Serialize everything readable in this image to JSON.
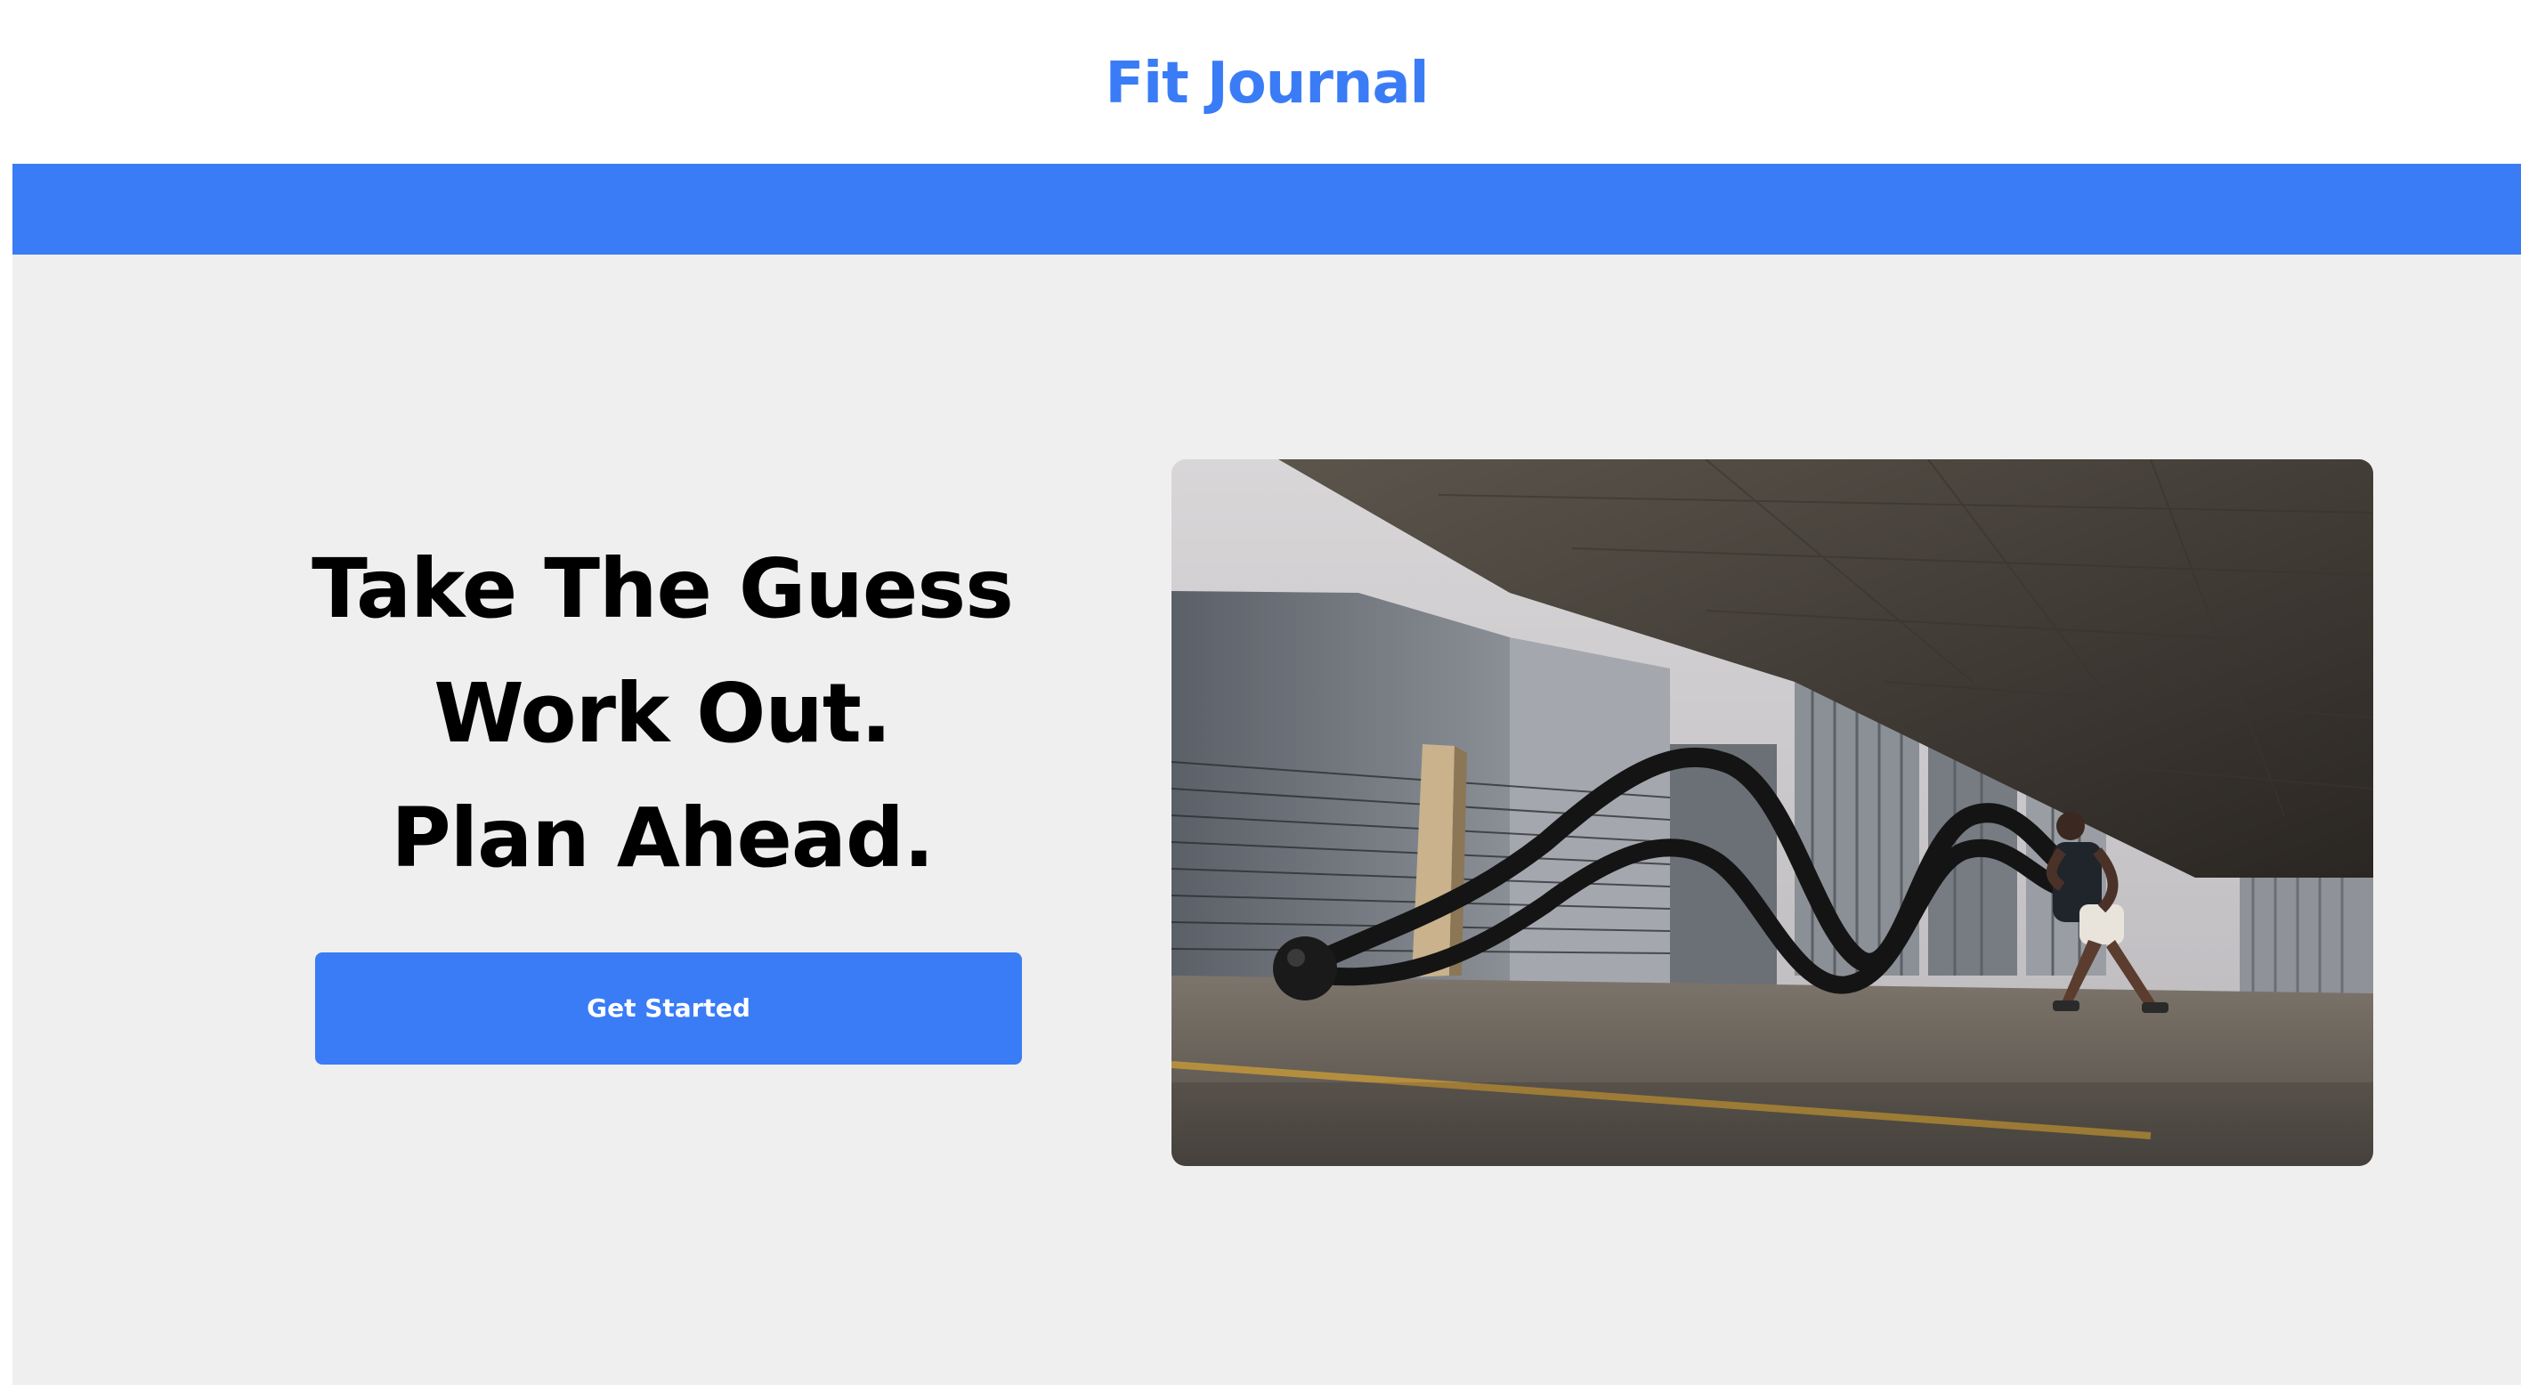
{
  "header": {
    "brand_title": "Fit Journal"
  },
  "hero": {
    "headline_lines": [
      "Take The Guess",
      "Work Out.",
      "Plan Ahead."
    ],
    "cta_label": "Get Started",
    "image_subject": "man-training-with-battle-ropes"
  },
  "colors": {
    "accent": "#397cf6",
    "hero_background": "#efefef",
    "header_background": "#ffffff",
    "headline": "#000000",
    "cta_text": "#ffffff"
  }
}
